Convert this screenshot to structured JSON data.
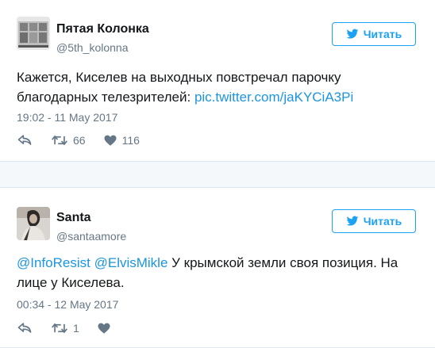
{
  "colors": {
    "accent": "#1da1f2",
    "link": "#1b95e0",
    "muted": "#657786",
    "border": "#e1e8ed",
    "page_bg": "#f5f8fa"
  },
  "tweets": [
    {
      "name": "Пятая Колонка",
      "handle": "@5th_kolonna",
      "follow_label": "Читать",
      "text_before": "Кажется, Киселев на выходных повстречал парочку благодарных телезрителей: ",
      "link": "pic.twitter.com/jaKYCiA3Pi",
      "timestamp": "19:02 - 11 May 2017",
      "retweets": "66",
      "likes": "116",
      "avatar_icon": "user-avatar"
    },
    {
      "name": "Santa",
      "handle": "@santaamore",
      "follow_label": "Читать",
      "mention1": "@InfoResist",
      "mention2": "@ElvisMikle",
      "text_after": " У крымской земли своя позиция. На лице у Киселева.",
      "timestamp": "00:34 - 12 May 2017",
      "retweets": "1",
      "likes": "",
      "avatar_icon": "user-avatar"
    }
  ],
  "icons": {
    "reply": "reply-icon",
    "retweet": "retweet-icon",
    "like": "heart-icon",
    "twitter": "twitter-bird-icon"
  }
}
